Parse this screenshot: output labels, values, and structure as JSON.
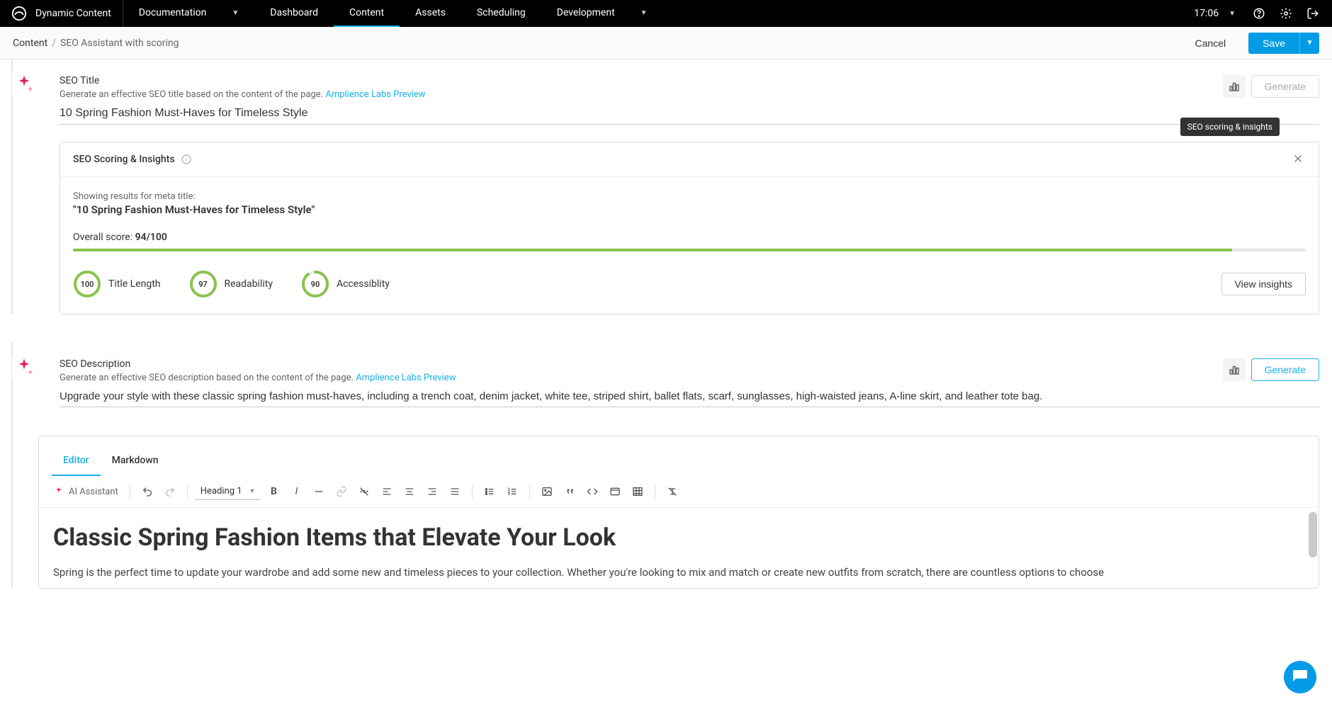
{
  "brand": "Dynamic Content",
  "top_nav": {
    "documentation": "Documentation",
    "items": [
      "Dashboard",
      "Content",
      "Assets",
      "Scheduling"
    ],
    "development": "Development",
    "time": "17:06"
  },
  "breadcrumb": {
    "root": "Content",
    "current": "SEO Assistant with scoring",
    "cancel": "Cancel",
    "save": "Save"
  },
  "seo_title": {
    "label": "SEO Title",
    "subtitle": "Generate an effective SEO title based on the content of the page.",
    "preview_link": "Amplience Labs Preview",
    "value": "10 Spring Fashion Must-Haves for Timeless Style",
    "generate_btn": "Generate",
    "tooltip": "SEO scoring & insights"
  },
  "insights": {
    "title": "SEO Scoring & Insights",
    "showing_for": "Showing results for meta title:",
    "meta_title": "\"10 Spring Fashion Must-Haves for Timeless Style\"",
    "overall_label": "Overall score:",
    "overall_score": "94/100",
    "overall_pct": 94,
    "metrics": [
      {
        "score": 100,
        "label": "Title Length"
      },
      {
        "score": 97,
        "label": "Readability"
      },
      {
        "score": 90,
        "label": "Accessiblity"
      }
    ],
    "view_btn": "View insights"
  },
  "seo_description": {
    "label": "SEO Description",
    "subtitle": "Generate an effective SEO description based on the content of the page.",
    "preview_link": "Amplience Labs Preview",
    "value": "Upgrade your style with these classic spring fashion must-haves, including a trench coat, denim jacket, white tee, striped shirt, ballet flats, scarf, sunglasses, high-waisted jeans, A-line skirt, and leather tote bag.",
    "generate_btn": "Generate"
  },
  "editor": {
    "tabs": {
      "editor": "Editor",
      "markdown": "Markdown"
    },
    "ai_assistant": "AI Assistant",
    "heading": "Heading 1",
    "content_heading": "Classic Spring Fashion Items that Elevate Your Look",
    "content_para": "Spring is the perfect time to update your wardrobe and add some new and timeless pieces to your collection. Whether you're looking to mix and match or create new outfits from scratch, there are countless options to choose"
  },
  "chart_data": {
    "type": "bar",
    "title": "SEO Scoring & Insights",
    "overall": 94,
    "categories": [
      "Title Length",
      "Readability",
      "Accessiblity"
    ],
    "values": [
      100,
      97,
      90
    ],
    "ylim": [
      0,
      100
    ]
  }
}
